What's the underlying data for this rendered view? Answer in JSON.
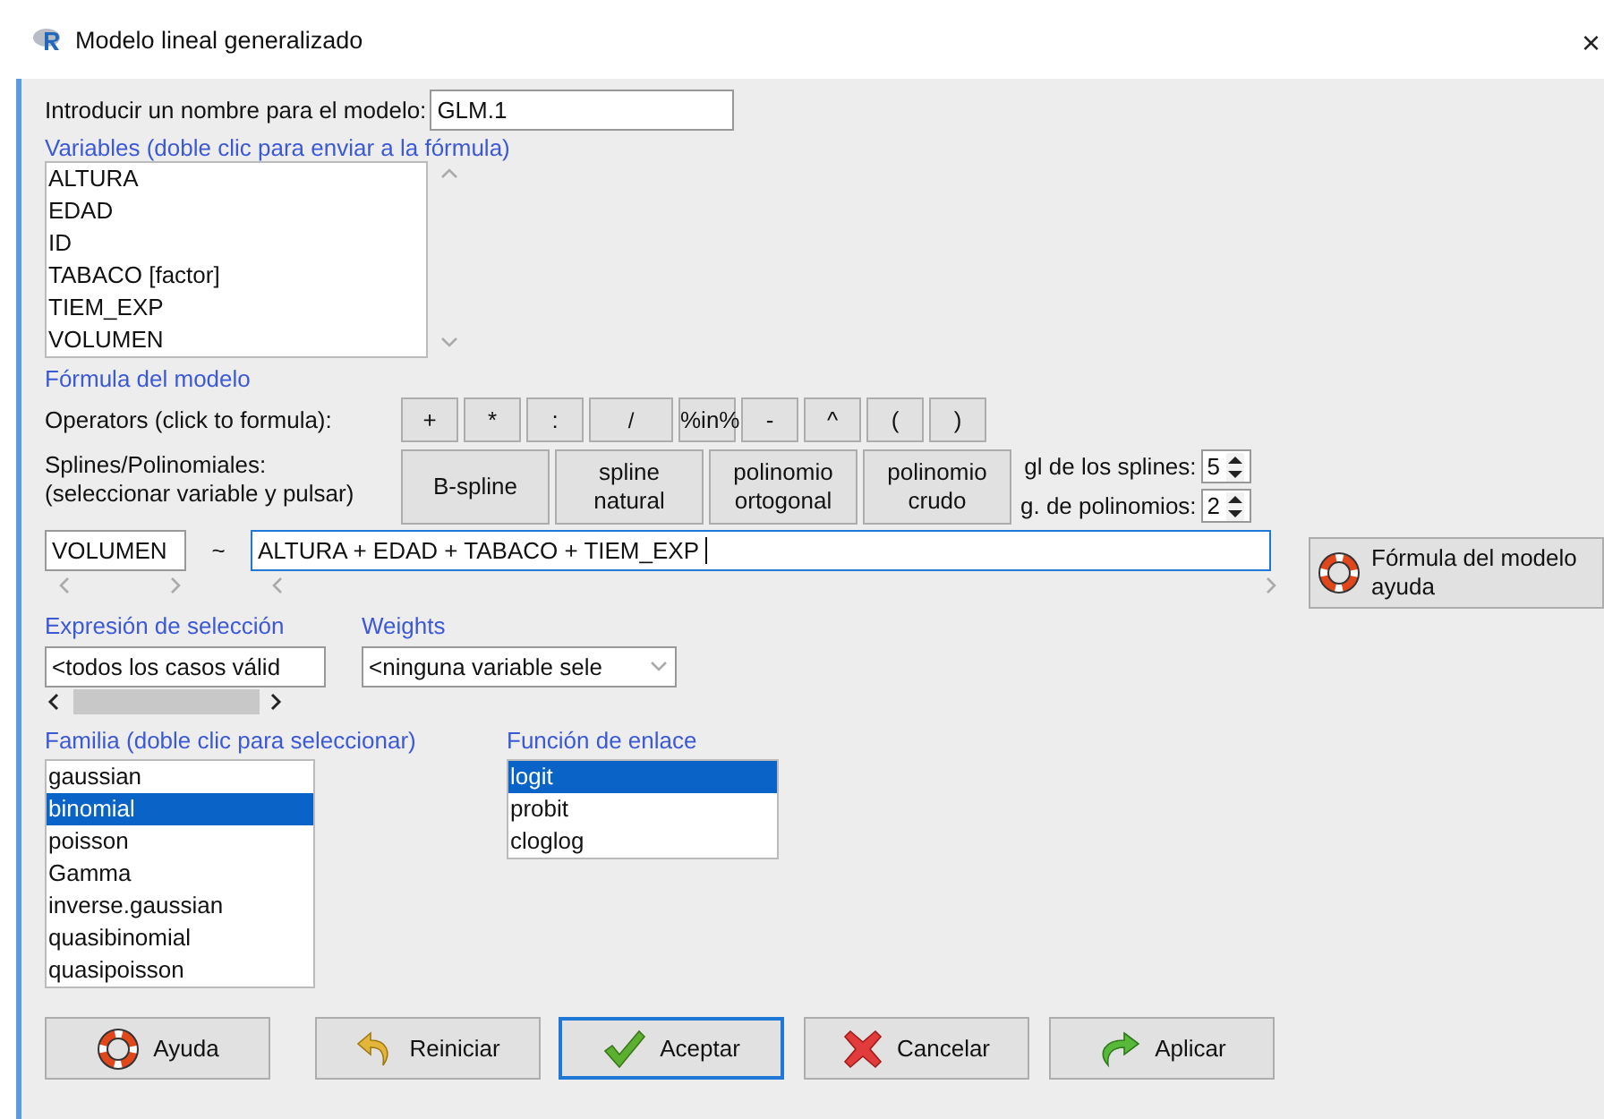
{
  "window": {
    "title": "Modelo lineal generalizado",
    "close": "×"
  },
  "model_name": {
    "label": "Introducir un nombre para el modelo:",
    "value": "GLM.1"
  },
  "variables": {
    "label": "Variables (doble clic para enviar a la fórmula)",
    "items": [
      "ALTURA",
      "EDAD",
      "ID",
      "TABACO [factor]",
      "TIEM_EXP",
      "VOLUMEN"
    ]
  },
  "formula": {
    "label": "Fórmula del modelo",
    "operators_label": "Operators (click to formula):",
    "operators": [
      "+",
      "*",
      ":",
      "/",
      "%in%",
      "-",
      "^",
      "(",
      ")"
    ],
    "splines_label": [
      "Splines/Polinomiales:",
      "(seleccionar variable y pulsar)"
    ],
    "spline_buttons": [
      {
        "lines": [
          "B-spline"
        ]
      },
      {
        "lines": [
          "spline",
          "natural"
        ]
      },
      {
        "lines": [
          "polinomio",
          "ortogonal"
        ]
      },
      {
        "lines": [
          "polinomio",
          "crudo"
        ]
      }
    ],
    "spline_df": {
      "label": "gl de los splines:",
      "value": "5"
    },
    "poly_degree": {
      "label": "g. de polinomios:",
      "value": "2"
    },
    "response": "VOLUMEN",
    "tilde": "~",
    "rhs": "ALTURA + EDAD + TABACO + TIEM_EXP",
    "help_button": [
      "Fórmula del modelo",
      "ayuda"
    ]
  },
  "subset": {
    "label": "Expresión de selección",
    "value": "<todos los casos válid"
  },
  "weights": {
    "label": "Weights",
    "value": "<ninguna variable sele"
  },
  "family": {
    "label": "Familia (doble clic para seleccionar)",
    "items": [
      {
        "name": "gaussian",
        "selected": false
      },
      {
        "name": "binomial",
        "selected": true
      },
      {
        "name": "poisson",
        "selected": false
      },
      {
        "name": "Gamma",
        "selected": false
      },
      {
        "name": "inverse.gaussian",
        "selected": false
      },
      {
        "name": "quasibinomial",
        "selected": false
      },
      {
        "name": "quasipoisson",
        "selected": false
      }
    ]
  },
  "link": {
    "label": "Función de enlace",
    "items": [
      {
        "name": "logit",
        "selected": true
      },
      {
        "name": "probit",
        "selected": false
      },
      {
        "name": "cloglog",
        "selected": false
      }
    ]
  },
  "buttons": [
    {
      "label": "Ayuda",
      "kind": "help",
      "default": false
    },
    {
      "label": "Reiniciar",
      "kind": "reset",
      "default": false
    },
    {
      "label": "Aceptar",
      "kind": "ok",
      "default": true
    },
    {
      "label": "Cancelar",
      "kind": "cancel",
      "default": false
    },
    {
      "label": "Aplicar",
      "kind": "apply",
      "default": false
    }
  ]
}
